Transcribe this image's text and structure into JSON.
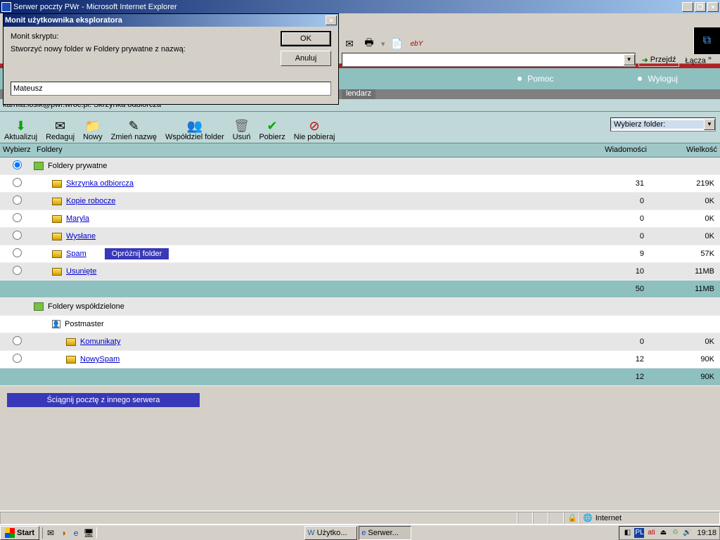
{
  "window": {
    "title": "Serwer poczty PWr - Microsoft Internet Explorer"
  },
  "dialog": {
    "title": "Monit użytkownika eksploratora",
    "label1": "Monit skryptu:",
    "label2": "Stworzyć nowy folder w Foldery prywatne z nazwą:",
    "value": "Mateusz",
    "ok": "OK",
    "cancel": "Anuluj"
  },
  "ie": {
    "go": "Przejdź",
    "links": "Łącza",
    "ebay": "ebY"
  },
  "nav": {
    "pomoc": "Pomoc",
    "wyloguj": "Wyloguj",
    "kalendarz": "lendarz"
  },
  "account": "kamila.losik@pwr.wroc.pl: Skrzynka odbiorcza",
  "toolbar": {
    "aktualizuj": "Aktualizuj",
    "redaguj": "Redaguj",
    "nowy": "Nowy",
    "zmien": "Zmień nazwę",
    "wspol": "Współdziel folder",
    "usun": "Usuń",
    "pobierz": "Pobierz",
    "niepobieraj": "Nie pobieraj",
    "select": "Wybierz folder:"
  },
  "headers": {
    "wybierz": "Wybierz",
    "foldery": "Foldery",
    "wiad": "Wiadomości",
    "wielkosc": "Wielkość"
  },
  "rows": {
    "priv": "Foldery prywatne",
    "inbox": "Skrzynka odbiorcza",
    "drafts": "Kopie robocze",
    "maryla": "Maryla",
    "sent": "Wysłane",
    "spam": "Spam",
    "oproznij": "Opróżnij folder",
    "trash": "Usunięte",
    "shared": "Foldery współdzielone",
    "postmaster": "Postmaster",
    "komunikaty": "Komunikaty",
    "nowyspam": "NowySpam"
  },
  "vals": {
    "inbox_m": "31",
    "inbox_s": "219K",
    "drafts_m": "0",
    "drafts_s": "0K",
    "maryla_m": "0",
    "maryla_s": "0K",
    "sent_m": "0",
    "sent_s": "0K",
    "spam_m": "9",
    "spam_s": "57K",
    "trash_m": "10",
    "trash_s": "11MB",
    "sub1_m": "50",
    "sub1_s": "11MB",
    "kom_m": "0",
    "kom_s": "0K",
    "ns_m": "12",
    "ns_s": "90K",
    "sub2_m": "12",
    "sub2_s": "90K"
  },
  "fetch_btn": "Ściągnij pocztę z innego serwera",
  "status": {
    "zone": "Internet"
  },
  "taskbar": {
    "start": "Start",
    "t1": "Użytko...",
    "t2": "Serwer...",
    "lang": "PL",
    "clock": "19:18"
  }
}
